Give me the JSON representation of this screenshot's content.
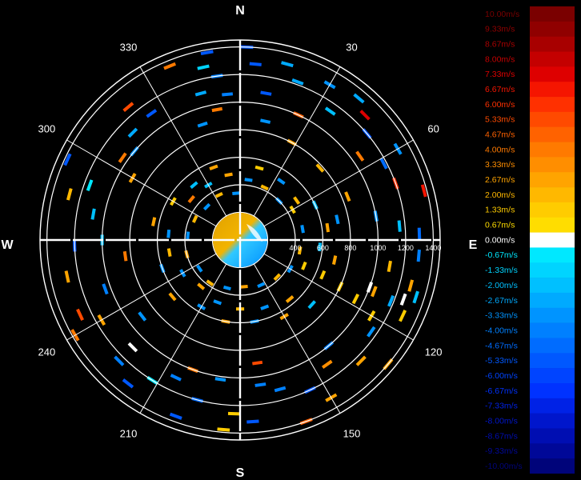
{
  "chart_data": {
    "type": "radar-ppi",
    "cardinals": {
      "north": "N",
      "east": "E",
      "south": "S",
      "west": "W"
    },
    "azimuth_labels": [
      "30",
      "60",
      "120",
      "150",
      "210",
      "240",
      "300",
      "330"
    ],
    "azimuth_values": [
      30,
      60,
      120,
      150,
      210,
      240,
      300,
      330
    ],
    "range_rings": [
      200,
      400,
      600,
      800,
      1000,
      1200,
      1400
    ],
    "range_labels": [
      "400",
      "600",
      "800",
      "1000",
      "1200",
      "1400"
    ],
    "range_max": 1450,
    "colorbar": {
      "labels": [
        "10.00m/s",
        "9.33m/s",
        "8.67m/s",
        "8.00m/s",
        "7.33m/s",
        "6.67m/s",
        "6.00m/s",
        "5.33m/s",
        "4.67m/s",
        "4.00m/s",
        "3.33m/s",
        "2.67m/s",
        "2.00m/s",
        "1.33m/s",
        "0.67m/s",
        "0.00m/s",
        "-0.67m/s",
        "-1.33m/s",
        "-2.00m/s",
        "-2.67m/s",
        "-3.33m/s",
        "-4.00m/s",
        "-4.67m/s",
        "-5.33m/s",
        "-6.00m/s",
        "-6.67m/s",
        "-7.33m/s",
        "-8.00m/s",
        "-8.67m/s",
        "-9.33m/s",
        "-10.00m/s"
      ],
      "colors": [
        "#7a0000",
        "#900000",
        "#a80000",
        "#c40000",
        "#de0000",
        "#f51500",
        "#ff3000",
        "#ff4a00",
        "#ff6200",
        "#ff7a00",
        "#ff8e00",
        "#ffa400",
        "#ffb800",
        "#ffcc00",
        "#ffdd00",
        "#ffffff",
        "#00e8ff",
        "#00d4ff",
        "#00c0ff",
        "#00aaff",
        "#0094ff",
        "#0080ff",
        "#006cff",
        "#0058ff",
        "#0044ff",
        "#0032ff",
        "#0022e6",
        "#0016cc",
        "#000eb2",
        "#000898",
        "#00047a"
      ]
    },
    "velocity_unit": "m/s",
    "velocity_range": [
      -10,
      10
    ],
    "gates": [
      [
        338,
        1360,
        4.0
      ],
      [
        348,
        1280,
        -1.5
      ],
      [
        352,
        1200,
        -4.0
      ],
      [
        345,
        1100,
        -2.5
      ],
      [
        320,
        1260,
        5.5
      ],
      [
        325,
        1120,
        -5.0
      ],
      [
        315,
        1100,
        -2.5
      ],
      [
        310,
        1000,
        -3.0
      ],
      [
        305,
        1040,
        4.0
      ],
      [
        300,
        900,
        3.0
      ],
      [
        295,
        1380,
        -5.0
      ],
      [
        290,
        1160,
        -0.7
      ],
      [
        285,
        1280,
        2.0
      ],
      [
        280,
        1080,
        -2.0
      ],
      [
        270,
        1000,
        -2.0
      ],
      [
        268,
        1200,
        -5.0
      ],
      [
        262,
        840,
        4.0
      ],
      [
        258,
        1280,
        3.0
      ],
      [
        250,
        1040,
        -4.0
      ],
      [
        245,
        1280,
        5.5
      ],
      [
        240,
        1160,
        3.0
      ],
      [
        232,
        900,
        -3.0
      ],
      [
        225,
        1240,
        -4.0
      ],
      [
        218,
        1320,
        -5.0
      ],
      [
        212,
        1200,
        -0.7
      ],
      [
        205,
        1100,
        -4.0
      ],
      [
        200,
        1360,
        -5.0
      ],
      [
        195,
        1200,
        -4.5
      ],
      [
        188,
        1020,
        -3.0
      ],
      [
        182,
        1260,
        1.3
      ],
      [
        176,
        1320,
        -5.0
      ],
      [
        172,
        1060,
        -4.0
      ],
      [
        165,
        1120,
        -4.0
      ],
      [
        160,
        1400,
        5.0
      ],
      [
        155,
        1200,
        -5.0
      ],
      [
        150,
        1320,
        3.0
      ],
      [
        145,
        1100,
        3.5
      ],
      [
        140,
        1000,
        -4.0
      ],
      [
        135,
        1240,
        3.0
      ],
      [
        130,
        1400,
        2.5
      ],
      [
        125,
        1160,
        -3.0
      ],
      [
        120,
        1100,
        1.3
      ],
      [
        117,
        940,
        1.3
      ],
      [
        115,
        800,
        1.3
      ],
      [
        113,
        650,
        1.3
      ],
      [
        112,
        500,
        1.3
      ],
      [
        111,
        1040,
        2.5
      ],
      [
        110,
        1000,
        0.0
      ],
      [
        112,
        1180,
        -2.5
      ],
      [
        115,
        1300,
        1.3
      ],
      [
        105,
        1280,
        3.0
      ],
      [
        100,
        1100,
        2.0
      ],
      [
        95,
        1300,
        -4.0
      ],
      [
        88,
        1300,
        -4.5
      ],
      [
        85,
        1160,
        -2.0
      ],
      [
        80,
        1000,
        -3.0
      ],
      [
        75,
        1380,
        6.5
      ],
      [
        70,
        1200,
        6.0
      ],
      [
        62,
        1180,
        -4.5
      ],
      [
        60,
        1320,
        -3.0
      ],
      [
        55,
        1060,
        4.0
      ],
      [
        50,
        1200,
        -5.0
      ],
      [
        45,
        1280,
        7.5
      ],
      [
        40,
        1340,
        -2.5
      ],
      [
        35,
        1140,
        -2.0
      ],
      [
        30,
        1300,
        -3.0
      ],
      [
        25,
        1000,
        4.5
      ],
      [
        20,
        1220,
        -2.5
      ],
      [
        15,
        1320,
        -2.5
      ],
      [
        10,
        1080,
        -5.0
      ],
      [
        5,
        1280,
        -5.0
      ],
      [
        2,
        1400,
        -5.0
      ],
      [
        355,
        1060,
        -4.0
      ],
      [
        350,
        960,
        4.0
      ],
      [
        342,
        880,
        -3.0
      ],
      [
        12,
        880,
        -3.0
      ],
      [
        28,
        800,
        3.0
      ],
      [
        48,
        780,
        2.0
      ],
      [
        68,
        840,
        3.0
      ],
      [
        78,
        720,
        -3.0
      ],
      [
        102,
        700,
        3.0
      ],
      [
        132,
        700,
        -2.0
      ],
      [
        150,
        640,
        3.0
      ],
      [
        170,
        600,
        -3.0
      ],
      [
        190,
        600,
        3.0
      ],
      [
        210,
        560,
        -3.0
      ],
      [
        230,
        640,
        3.0
      ],
      [
        250,
        600,
        -3.0
      ],
      [
        282,
        640,
        3.0
      ],
      [
        300,
        560,
        1.3
      ],
      [
        320,
        520,
        -2.0
      ],
      [
        340,
        560,
        3.0
      ],
      [
        15,
        540,
        1.3
      ],
      [
        35,
        520,
        -3.0
      ],
      [
        55,
        500,
        2.0
      ],
      [
        65,
        600,
        -2.0
      ],
      [
        82,
        640,
        3.0
      ],
      [
        95,
        580,
        -2.0
      ],
      [
        140,
        560,
        3.0
      ],
      [
        160,
        520,
        -3.0
      ],
      [
        180,
        500,
        2.0
      ],
      [
        200,
        480,
        -3.0
      ],
      [
        220,
        440,
        3.0
      ],
      [
        240,
        480,
        -3.0
      ],
      [
        260,
        520,
        2.0
      ],
      [
        275,
        520,
        -3.0
      ],
      [
        310,
        460,
        4.0
      ],
      [
        330,
        460,
        -2.0
      ],
      [
        350,
        480,
        3.0
      ],
      [
        8,
        440,
        -3.0
      ],
      [
        25,
        420,
        2.0
      ],
      [
        45,
        400,
        -3.0
      ],
      [
        60,
        440,
        1.3
      ],
      [
        80,
        460,
        -3.0
      ],
      [
        100,
        440,
        2.0
      ],
      [
        120,
        420,
        -3.0
      ],
      [
        135,
        380,
        2.0
      ],
      [
        155,
        360,
        -3.0
      ],
      [
        175,
        340,
        3.0
      ],
      [
        195,
        360,
        -3.0
      ],
      [
        215,
        380,
        2.0
      ],
      [
        235,
        360,
        -3.0
      ],
      [
        255,
        400,
        3.0
      ],
      [
        275,
        380,
        -3.0
      ],
      [
        295,
        360,
        2.0
      ],
      [
        315,
        340,
        -3.0
      ],
      [
        335,
        360,
        2.0
      ],
      [
        355,
        340,
        -3.0
      ],
      [
        172,
        900,
        5.5
      ],
      [
        185,
        1380,
        1.3
      ],
      [
        240,
        1380,
        4.0
      ],
      [
        225,
        1100,
        0.0
      ],
      [
        200,
        1000,
        4.0
      ],
      [
        110,
        1260,
        0.0
      ],
      [
        108,
        1340,
        -2.0
      ],
      [
        350,
        1380,
        -5.0
      ]
    ]
  }
}
